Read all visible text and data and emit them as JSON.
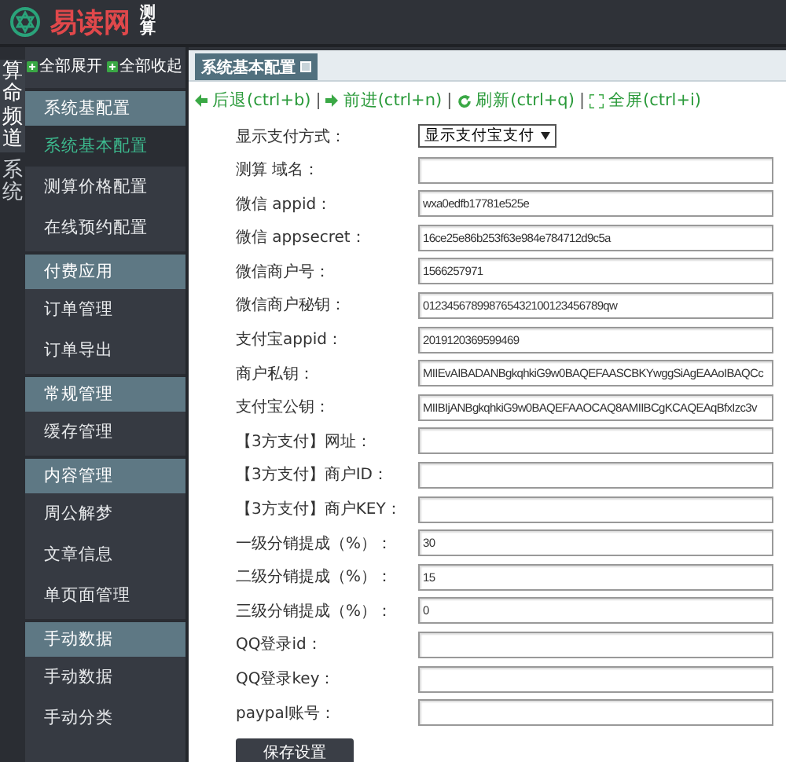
{
  "header": {
    "logo_text": "易读网",
    "logo_sub": "测算"
  },
  "channels": [
    {
      "label": "算命频道",
      "selected": true
    },
    {
      "label": "系统",
      "selected": false
    }
  ],
  "sidebar": {
    "actions": [
      "全部展开",
      "全部收起"
    ],
    "groups": [
      {
        "title": "系统基配置",
        "items": [
          {
            "label": "系统基本配置",
            "selected": true
          },
          {
            "label": "测算价格配置",
            "selected": false
          },
          {
            "label": "在线预约配置",
            "selected": false
          }
        ]
      },
      {
        "title": "付费应用",
        "items": [
          {
            "label": "订单管理",
            "selected": false
          },
          {
            "label": "订单导出",
            "selected": false
          }
        ]
      },
      {
        "title": "常规管理",
        "items": [
          {
            "label": "缓存管理",
            "selected": false
          }
        ]
      },
      {
        "title": "内容管理",
        "items": [
          {
            "label": "周公解梦",
            "selected": false
          },
          {
            "label": "文章信息",
            "selected": false
          },
          {
            "label": "单页面管理",
            "selected": false
          }
        ]
      },
      {
        "title": "手动数据",
        "items": [
          {
            "label": "手动数据",
            "selected": false
          },
          {
            "label": "手动分类",
            "selected": false
          }
        ]
      }
    ]
  },
  "tabs": [
    {
      "label": "系统基本配置",
      "selected": true
    }
  ],
  "toolbar": {
    "separator": "|",
    "items": [
      {
        "kind": "back",
        "label": "后退(ctrl+b)"
      },
      {
        "kind": "forward",
        "label": "前进(ctrl+n)"
      },
      {
        "kind": "refresh",
        "label": "刷新(ctrl+q)"
      },
      {
        "kind": "fullscreen",
        "label": "全屏(ctrl+i)"
      }
    ]
  },
  "form": {
    "fields": [
      {
        "kind": "select",
        "label": "显示支付方式：",
        "value": "显示支付宝支付"
      },
      {
        "kind": "text",
        "label": "测算 域名："
      },
      {
        "kind": "text",
        "label": "微信 appid：",
        "value": "wxa0edfb17781e525e"
      },
      {
        "kind": "text",
        "label": "微信 appsecret：",
        "value": "16ce25e86b253f63e984e784712d9c5a"
      },
      {
        "kind": "text",
        "label": "微信商户号：",
        "value": "1566257971"
      },
      {
        "kind": "text",
        "label": "微信商户秘钥：",
        "value": "012345678998765432100123456789qw"
      },
      {
        "kind": "text",
        "label": "支付宝appid：",
        "value": "2019120369599469"
      },
      {
        "kind": "text",
        "label": "商户私钥：",
        "value": "MIIEvAIBADANBgkqhkiG9w0BAQEFAASCBKYwggSiAgEAAoIBAQCc"
      },
      {
        "kind": "text",
        "label": "支付宝公钥：",
        "value": "MIIBIjANBgkqhkiG9w0BAQEFAAOCAQ8AMIIBCgKCAQEAqBfxIzc3v"
      },
      {
        "kind": "text",
        "label": "【3方支付】网址："
      },
      {
        "kind": "text",
        "label": "【3方支付】商户ID："
      },
      {
        "kind": "text",
        "label": "【3方支付】商户KEY："
      },
      {
        "kind": "text",
        "label": "一级分销提成（%）：",
        "value": "30"
      },
      {
        "kind": "text",
        "label": "二级分销提成（%）：",
        "value": "15"
      },
      {
        "kind": "text",
        "label": "三级分销提成（%）：",
        "value": "0"
      },
      {
        "kind": "text",
        "label": "QQ登录id："
      },
      {
        "kind": "text",
        "label": "QQ登录key："
      },
      {
        "kind": "text",
        "label": "paypal账号："
      }
    ],
    "submit": "保存设置"
  }
}
